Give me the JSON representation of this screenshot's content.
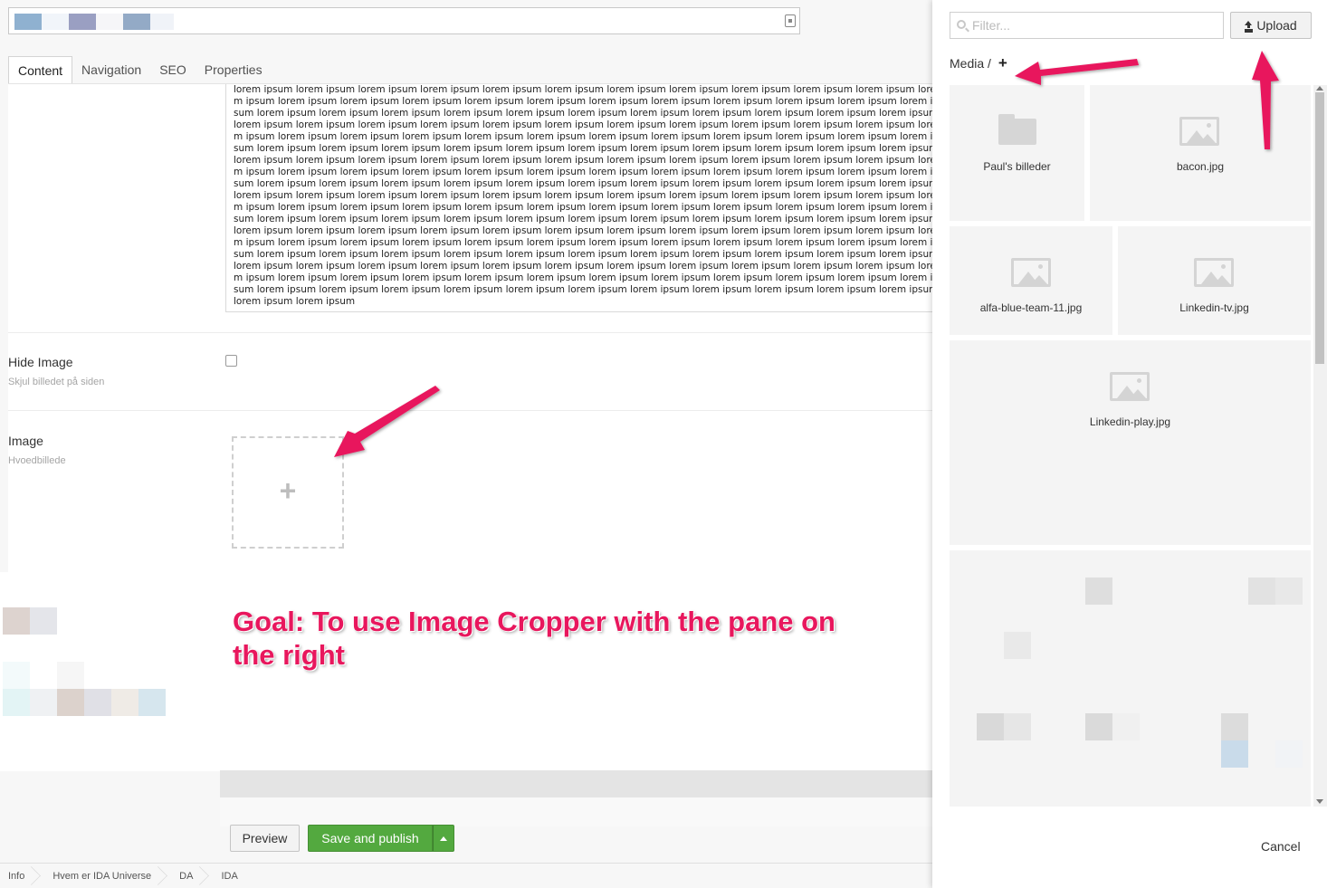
{
  "editor": {
    "tabs": [
      {
        "label": "Content"
      },
      {
        "label": "Navigation"
      },
      {
        "label": "SEO"
      },
      {
        "label": "Properties"
      }
    ],
    "rte_text": "lorem ipsum lorem ipsum lorem ipsum lorem ipsum lorem ipsum lorem ipsum lorem ipsum lorem ipsum lorem ipsum lorem ipsum lorem ipsum lorem ipsum lorem ipsum lorem ipsum lorem ipsum lorem ipsum lorem ipsum lorem ipsum lorem ipsum lorem ipsum lorem ipsum lorem ipsum lorem ipsum lorem ipsum lorem ipsum lorem ipsum lorem ipsum lorem ipsum lorem ipsum lorem ipsum lorem ipsum lorem ipsum lorem ipsum lorem ipsum lorem ipsum lorem ipsum lorem ipsum lorem ipsum lorem ipsum lorem ipsum lorem ipsum lorem ipsum lorem ipsum lorem ipsum lorem ipsum lorem ipsum lorem ipsum lorem ipsum lorem ipsum lorem ipsum lorem ipsum lorem ipsum lorem ipsum lorem ipsum lorem ipsum lorem ipsum lorem ipsum lorem ipsum lorem ipsum lorem ipsum lorem ipsum lorem ipsum lorem ipsum lorem ipsum lorem ipsum lorem ipsum lorem ipsum lorem ipsum lorem ipsum lorem ipsum lorem ipsum lorem ipsum lorem ipsum lorem ipsum lorem ipsum lorem ipsum lorem ipsum lorem ipsum lorem ipsum lorem ipsum lorem ipsum lorem ipsum lorem ipsum lorem ipsum lorem ipsum lorem ipsum lorem ipsum lorem ipsum lorem ipsum lorem ipsum lorem ipsum lorem ipsum lorem ipsum lorem ipsum lorem ipsum lorem ipsum lorem ipsum lorem ipsum lorem ipsum lorem ipsum lorem ipsum lorem ipsum lorem ipsum lorem ipsum lorem ipsum lorem ipsum lorem ipsum lorem ipsum lorem ipsum lorem ipsum lorem ipsum lorem ipsum lorem ipsum lorem ipsum lorem ipsum lorem ipsum lorem ipsum lorem ipsum lorem ipsum lorem ipsum lorem ipsum lorem ipsum lorem ipsum lorem ipsum lorem ipsum lorem ipsum lorem ipsum lorem ipsum lorem ipsum lorem ipsum lorem ipsum lorem ipsum lorem ipsum lorem ipsum lorem ipsum lorem ipsum lorem ipsum lorem ipsum lorem ipsum lorem ipsum lorem ipsum lorem ipsum lorem ipsum lorem ipsum lorem ipsum lorem ipsum lorem ipsum lorem ipsum lorem ipsum lorem ipsum lorem ipsum lorem ipsum lorem ipsum lorem ipsum lorem ipsum lorem ipsum lorem ipsum lorem ipsum lorem ipsum lorem ipsum lorem ipsum lorem ipsum lorem ipsum lorem ipsum lorem ipsum lorem ipsum lorem ipsum lorem ipsum lorem ipsum lorem ipsum lorem ipsum lorem ipsum lorem ipsum lorem ipsum lorem ipsum lorem ipsum lorem ipsum lorem ipsum lorem ipsum lorem ipsum lorem ipsum lorem ipsum lorem ipsum lorem ipsum lorem ipsum lorem ipsum lorem ipsum lorem ipsum lorem ipsum lorem ipsum lorem ipsum lorem ipsum lorem ipsum lorem ipsum lorem ipsum lorem ipsum lorem ipsum lorem ipsum lorem ipsum lorem ipsum lorem ipsum lorem ipsum lorem ipsum lorem ipsum lorem ipsum lorem ipsum",
    "hide_image": {
      "label": "Hide Image",
      "description": "Skjul billedet på siden",
      "checked": false
    },
    "image": {
      "label": "Image",
      "description": "Hvoedbillede",
      "add_icon": "plus-icon"
    },
    "buttons": {
      "preview": "Preview",
      "save_publish": "Save and publish"
    },
    "breadcrumb": [
      "Info",
      "Hvem er IDA Universe",
      "DA",
      "IDA"
    ],
    "annotation": "Goal: To use Image Cropper with the pane on the right",
    "annotation_color": "#e8175d"
  },
  "media_pane": {
    "filter_placeholder": "Filter...",
    "upload_label": "Upload",
    "path_label": "Media /",
    "path_add": "+",
    "items": [
      {
        "name": "Paul's billeder",
        "kind": "folder"
      },
      {
        "name": "bacon.jpg",
        "kind": "image"
      },
      {
        "name": "alfa-blue-team-11.jpg",
        "kind": "image"
      },
      {
        "name": "Linkedin-tv.jpg",
        "kind": "image"
      },
      {
        "name": "Linkedin-play.jpg",
        "kind": "image"
      }
    ],
    "cancel_label": "Cancel"
  },
  "colors": {
    "save_green": "#53a93f",
    "annotation_pink": "#e8175d"
  }
}
